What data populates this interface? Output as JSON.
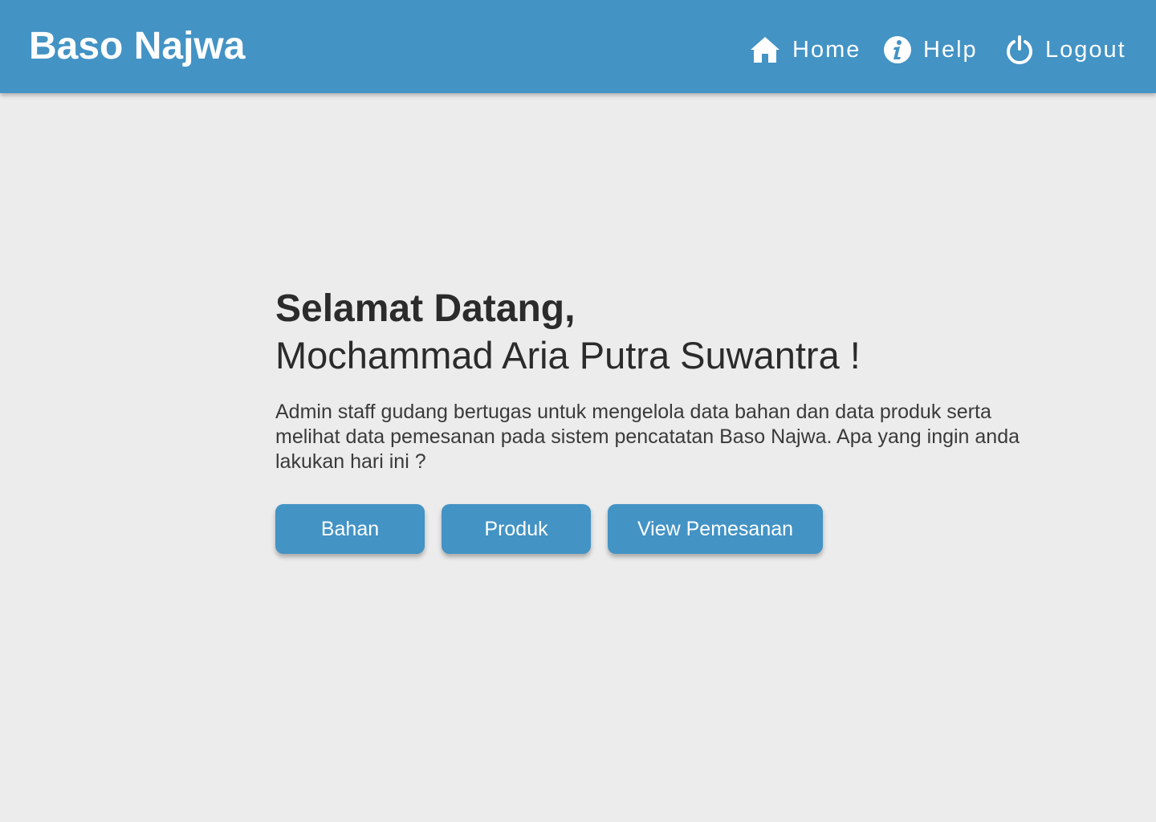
{
  "header": {
    "brand": "Baso Najwa",
    "nav": {
      "home": {
        "label": "Home",
        "icon": "home-icon"
      },
      "help": {
        "label": "Help",
        "icon": "info-icon"
      },
      "logout": {
        "label": "Logout",
        "icon": "power-icon"
      }
    }
  },
  "main": {
    "greeting": "Selamat Datang,",
    "user_name": "Mochammad Aria Putra Suwantra !",
    "description": "Admin staff gudang bertugas untuk mengelola data bahan dan data produk serta melihat data pemesanan pada sistem pencatatan Baso Najwa. Apa yang ingin anda lakukan hari ini ?",
    "buttons": {
      "bahan": "Bahan",
      "produk": "Produk",
      "view_pemesanan": "View Pemesanan"
    }
  },
  "colors": {
    "primary": "#4393c5",
    "background": "#ececec",
    "text": "#2b2b2b"
  }
}
